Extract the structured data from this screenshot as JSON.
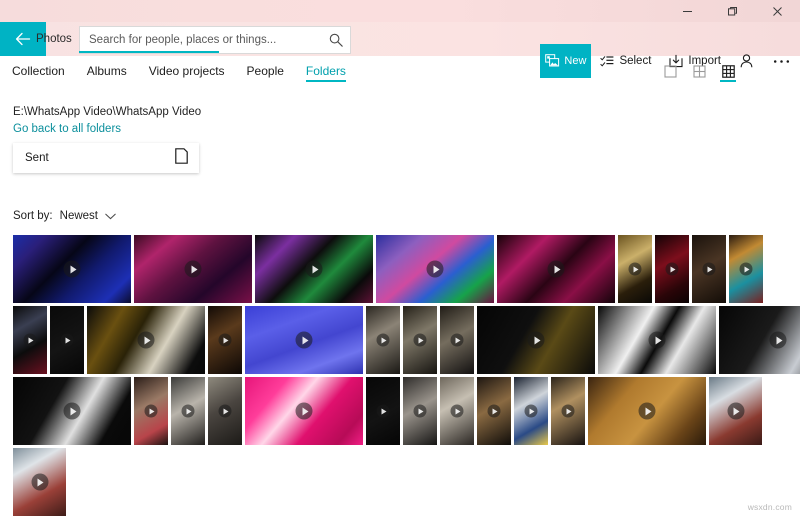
{
  "window": {
    "app_title": "Photos",
    "back_icon": "back-arrow-icon",
    "controls": [
      {
        "name": "minimize-button",
        "icon": "minimize-icon"
      },
      {
        "name": "restore-button",
        "icon": "restore-icon"
      },
      {
        "name": "close-button",
        "icon": "close-icon"
      }
    ]
  },
  "search": {
    "placeholder": "Search for people, places or things...",
    "value": "",
    "icon": "search-icon"
  },
  "commandbar": {
    "new_label": "New",
    "new_icon": "photos-new-icon",
    "select_label": "Select",
    "select_icon": "select-icon",
    "import_label": "Import",
    "import_icon": "import-icon",
    "account_icon": "person-icon",
    "more_icon": "ellipsis-icon"
  },
  "nav": {
    "tabs": [
      {
        "label": "Collection",
        "active": false
      },
      {
        "label": "Albums",
        "active": false
      },
      {
        "label": "Video projects",
        "active": false
      },
      {
        "label": "People",
        "active": false
      },
      {
        "label": "Folders",
        "active": true
      }
    ]
  },
  "viewmodes": [
    {
      "name": "view-single-button",
      "icon": "square-icon",
      "active": false
    },
    {
      "name": "view-medium-grid-button",
      "icon": "grid-2x2-icon",
      "active": false
    },
    {
      "name": "view-small-grid-button",
      "icon": "grid-3x3-icon",
      "active": true
    }
  ],
  "breadcrumb": {
    "path": "E:\\WhatsApp Video\\WhatsApp Video",
    "back_link": "Go back to all folders"
  },
  "folder_card": {
    "name": "Sent",
    "icon": "folder-page-icon"
  },
  "sort": {
    "label": "Sort by:",
    "value": "Newest",
    "chevron_icon": "chevron-down-icon"
  },
  "watermark": "wsxdn.com",
  "colors": {
    "accent": "#00b3c4",
    "accent_link": "#0b8f9c",
    "titlebar_pink": "#f9dedd",
    "text": "#1d1d1d"
  },
  "grid": {
    "rows": [
      {
        "height": 68,
        "items": [
          {
            "w": 118,
            "g": "linear-gradient(135deg,#1b2ea8 0%,#2a1f7a 18%,#060617 42%,#111a6e 62%,#1d2fb5 85%,#0b0b2c 100%)"
          },
          {
            "w": 118,
            "g": "linear-gradient(140deg,#3a0b22 0%,#b0246b 22%,#5e1240 45%,#24062a 70%,#7a1048 100%)"
          },
          {
            "w": 118,
            "g": "linear-gradient(135deg,#0a0a0a 0%,#7b2fa0 22%,#0d0d0d 44%,#1f8a3c 62%,#0a0a0a 82%,#5e1236 100%)"
          },
          {
            "w": 118,
            "g": "linear-gradient(140deg,#2b2f9e 0%,#8d5fbf 24%,#d04aa0 44%,#2a5fd0 62%,#16a34a 80%,#6b1040 100%)"
          },
          {
            "w": 118,
            "g": "linear-gradient(135deg,#160208 0%,#b01a63 28%,#2a0414 52%,#8a0f46 72%,#120309 100%)"
          },
          {
            "w": 34,
            "g": "linear-gradient(150deg,#6a5320 0%,#cbb06a 35%,#2a1e0b 70%,#090806 100%)",
            "small": true
          },
          {
            "w": 34,
            "g": "linear-gradient(150deg,#120305 0%,#7d0e1c 40%,#2a0508 75%,#0a0203 100%)",
            "small": true
          },
          {
            "w": 34,
            "g": "linear-gradient(150deg,#1a120c 0%,#4a3524 45%,#120c07 100%)",
            "small": true
          },
          {
            "w": 34,
            "g": "linear-gradient(150deg,#2a1b10 0%,#c28a33 30%,#1b90a0 65%,#7a2020 100%)",
            "small": true
          }
        ]
      },
      {
        "height": 68,
        "items": [
          {
            "w": 34,
            "g": "linear-gradient(150deg,#0a0a0a 0%,#3a3f52 30%,#0c0c0c 60%,#6b1020 100%)",
            "small": true
          },
          {
            "w": 34,
            "g": "linear-gradient(150deg,#0a0a0a 0%,#141414 55%,#060606 100%)",
            "small": true
          },
          {
            "w": 118,
            "g": "linear-gradient(120deg,#0a0a0a 0%,#6a5010 24%,#2a2208 42%,#d8d2c0 64%,#0d0d0d 88%,#070707 100%)"
          },
          {
            "w": 34,
            "g": "linear-gradient(150deg,#120a06 0%,#5a3a1c 40%,#0c0705 100%)",
            "small": true
          },
          {
            "w": 118,
            "g": "linear-gradient(160deg,#3a3fd6 0%,#5a5fe8 30%,#4346d0 55%,#6f74ee 78%,#2e32b0 100%)"
          },
          {
            "w": 34,
            "g": "linear-gradient(150deg,#2a2620 0%,#8b8376 40%,#1a1814 100%)",
            "small": true
          },
          {
            "w": 34,
            "g": "linear-gradient(150deg,#242018 0%,#7f7868 42%,#161410 100%)",
            "small": true
          },
          {
            "w": 34,
            "g": "linear-gradient(150deg,#201c16 0%,#756d5e 45%,#121010 100%)",
            "small": true
          },
          {
            "w": 118,
            "g": "linear-gradient(120deg,#050505 0%,#0f0f0f 40%,#5a4a16 62%,#0a0a0a 100%)"
          },
          {
            "w": 118,
            "g": "linear-gradient(120deg,#070707 0%,#f0f0f0 36%,#0a0a0a 52%,#e8e8e8 68%,#090909 100%)"
          },
          {
            "w": 118,
            "g": "linear-gradient(120deg,#060606 0%,#1a1a1a 40%,#c8ccd2 70%,#0b0b0b 100%)"
          }
        ]
      },
      {
        "height": 68,
        "items": [
          {
            "w": 118,
            "g": "linear-gradient(120deg,#050505 0%,#121212 35%,#e0e0e0 58%,#0a0a0a 80%,#070707 100%)"
          },
          {
            "w": 34,
            "g": "linear-gradient(150deg,#2a1d18 0%,#9a7a66 40%,#b8444a 75%,#1a1210 100%)",
            "small": true
          },
          {
            "w": 34,
            "g": "linear-gradient(150deg,#3a3a38 0%,#b9b4ab 45%,#201e1c 100%)",
            "small": true
          },
          {
            "w": 34,
            "g": "linear-gradient(150deg,#8f8a7e 0%,#4a4540 45%,#1c1a17 100%)",
            "small": true
          },
          {
            "w": 118,
            "g": "linear-gradient(130deg,#e6157a 0%,#ff3d9a 25%,#ffd6e8 42%,#e0106e 62%,#b70b57 85%,#f21f86 100%)"
          },
          {
            "w": 34,
            "g": "linear-gradient(150deg,#070707 0%,#131313 55%,#050505 100%)",
            "small": true
          },
          {
            "w": 34,
            "g": "linear-gradient(150deg,#2e2c2a 0%,#9a948c 45%,#161514 100%)",
            "small": true
          },
          {
            "w": 34,
            "g": "linear-gradient(150deg,#6e675c 0%,#c6bfb2 40%,#2a2622 100%)",
            "small": true
          },
          {
            "w": 34,
            "g": "linear-gradient(150deg,#1d1611 0%,#8a6a42 45%,#0f0c09 100%)",
            "small": true
          },
          {
            "w": 34,
            "g": "linear-gradient(150deg,#1a2230 0%,#cfd4da 38%,#2a4a86 72%,#e8c84a 100%)",
            "small": true
          },
          {
            "w": 34,
            "g": "linear-gradient(150deg,#2a231a 0%,#b09060 40%,#171210 100%)",
            "small": true
          },
          {
            "w": 118,
            "g": "linear-gradient(130deg,#3a2410 0%,#b07a2e 30%,#c89340 55%,#6a4418 80%,#2a1a0a 100%)"
          },
          {
            "w": 53,
            "g": "linear-gradient(150deg,#6a7a86 0%,#d8dde2 30%,#8a3a30 68%,#3a1a16 100%)"
          }
        ]
      },
      {
        "height": 68,
        "items": [
          {
            "w": 53,
            "g": "linear-gradient(150deg,#7f8f9a 0%,#dfe4e8 28%,#9a4038 66%,#3e1c18 100%)"
          }
        ]
      }
    ]
  }
}
